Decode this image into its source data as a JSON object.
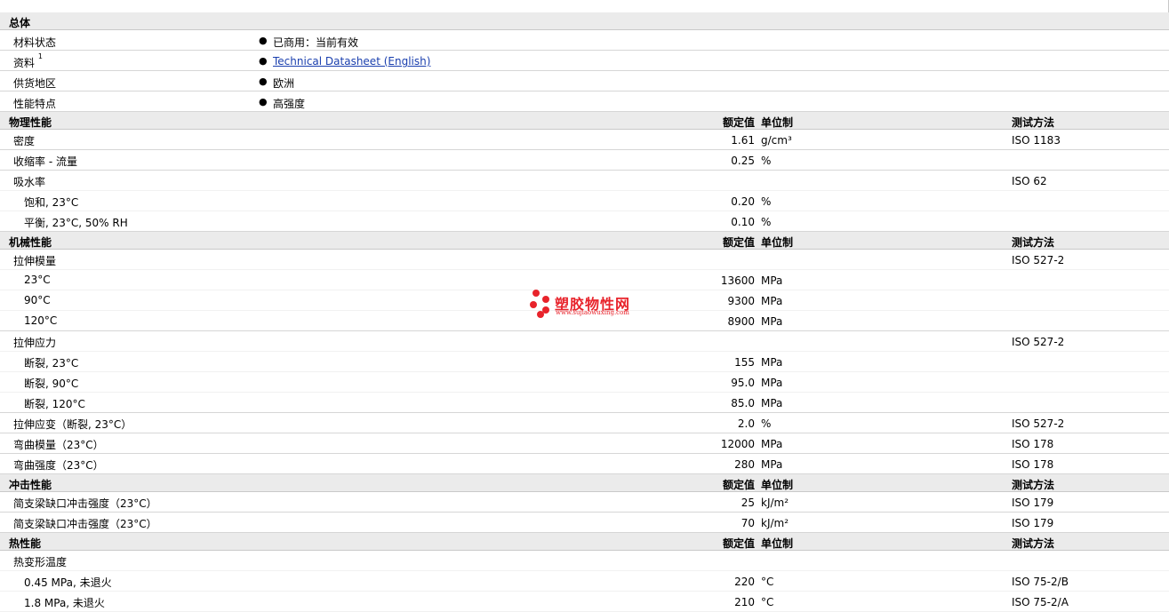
{
  "general": {
    "section_title": "总体",
    "rows": [
      {
        "label": "材料状态",
        "value": "已商用：当前有效"
      },
      {
        "label": "资料",
        "sup": "1",
        "value": "Technical Datasheet (English)"
      },
      {
        "label": "供货地区",
        "value": "欧洲"
      },
      {
        "label": "性能特点",
        "value": "高强度"
      }
    ]
  },
  "headers": {
    "value": "额定值",
    "unit": "单位制",
    "test": "测试方法"
  },
  "sections": [
    {
      "title": "物理性能",
      "rows": [
        {
          "label": "密度",
          "value": "1.61",
          "unit": "g/cm³",
          "test": "ISO 1183"
        },
        {
          "label": "收缩率 - 流量",
          "value": "0.25",
          "unit": "%",
          "test": ""
        },
        {
          "label": "吸水率",
          "value": "",
          "unit": "",
          "test": "ISO 62"
        },
        {
          "label": "饱和, 23°C",
          "value": "0.20",
          "unit": "%",
          "test": ""
        },
        {
          "label": "平衡, 23°C, 50% RH",
          "value": "0.10",
          "unit": "%",
          "test": ""
        }
      ]
    },
    {
      "title": "机械性能",
      "rows": [
        {
          "label": "拉伸模量",
          "value": "",
          "unit": "",
          "test": "ISO 527-2"
        },
        {
          "label": "23°C",
          "value": "13600",
          "unit": "MPa",
          "test": ""
        },
        {
          "label": "90°C",
          "value": "9300",
          "unit": "MPa",
          "test": ""
        },
        {
          "label": "120°C",
          "value": "8900",
          "unit": "MPa",
          "test": ""
        },
        {
          "label": "拉伸应力",
          "value": "",
          "unit": "",
          "test": "ISO 527-2"
        },
        {
          "label": "断裂, 23°C",
          "value": "155",
          "unit": "MPa",
          "test": ""
        },
        {
          "label": "断裂, 90°C",
          "value": "95.0",
          "unit": "MPa",
          "test": ""
        },
        {
          "label": "断裂, 120°C",
          "value": "85.0",
          "unit": "MPa",
          "test": ""
        },
        {
          "label": "拉伸应变（断裂, 23°C）",
          "value": "2.0",
          "unit": "%",
          "test": "ISO 527-2"
        },
        {
          "label": "弯曲模量（23°C）",
          "value": "12000",
          "unit": "MPa",
          "test": "ISO 178"
        },
        {
          "label": "弯曲强度（23°C）",
          "value": "280",
          "unit": "MPa",
          "test": "ISO 178"
        }
      ]
    },
    {
      "title": "冲击性能",
      "rows": [
        {
          "label": "简支梁缺口冲击强度（23°C）",
          "value": "25",
          "unit": "kJ/m²",
          "test": "ISO 179"
        },
        {
          "label": "简支梁缺口冲击强度（23°C）",
          "value": "70",
          "unit": "kJ/m²",
          "test": "ISO 179"
        }
      ]
    },
    {
      "title": "热性能",
      "rows": [
        {
          "label": "热变形温度",
          "value": "",
          "unit": "",
          "test": ""
        },
        {
          "label": "0.45 MPa, 未退火",
          "value": "220",
          "unit": "°C",
          "test": "ISO 75-2/B"
        },
        {
          "label": "1.8 MPa, 未退火",
          "value": "210",
          "unit": "°C",
          "test": "ISO 75-2/A"
        }
      ]
    }
  ],
  "watermark": {
    "name": "塑胶物性网",
    "url": "www.sujiaowuxing.com"
  },
  "colors": {
    "header_bg": "#ebebeb",
    "link": "#1a3fae",
    "watermark": "#e8232b"
  }
}
